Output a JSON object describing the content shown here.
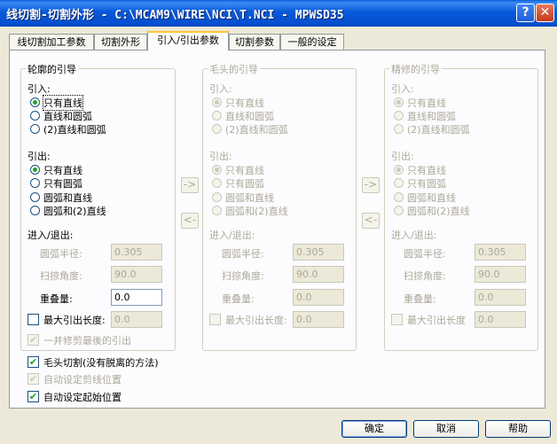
{
  "window": {
    "title": "线切割-切割外形 - C:\\MCAM9\\WIRE\\NCI\\T.NCI - MPWSD35",
    "help_glyph": "?",
    "close_glyph": "✕"
  },
  "tabs": [
    {
      "label": "线切割加工参数"
    },
    {
      "label": "切割外形"
    },
    {
      "label": "引入/引出参数"
    },
    {
      "label": "切割参数"
    },
    {
      "label": "一般的设定"
    }
  ],
  "groups": [
    {
      "title": "轮廓的引导",
      "enabled": true,
      "lead_in_label": "引入:",
      "lead_in_options": [
        "只有直线",
        "直线和圆弧",
        "(2)直线和圆弧"
      ],
      "lead_out_label": "引出:",
      "lead_out_options": [
        "只有直线",
        "只有圆弧",
        "圆弧和直线",
        "圆弧和(2)直线"
      ],
      "entry_exit_label": "进入/退出:",
      "arc_radius_label": "圆弧半径:",
      "arc_radius_value": "0.305",
      "sweep_angle_label": "扫掠角度:",
      "sweep_angle_value": "90.0",
      "overlap_label": "重叠量:",
      "overlap_value": "0.0",
      "max_lead_out_label": "最大引出长度:",
      "max_lead_out_value": "0.0",
      "trim_last_label": "一并修剪最後的引出"
    },
    {
      "title": "毛头的引导",
      "enabled": false,
      "lead_in_label": "引入:",
      "lead_in_options": [
        "只有直线",
        "直线和圆弧",
        "(2)直线和圆弧"
      ],
      "lead_out_label": "引出:",
      "lead_out_options": [
        "只有直线",
        "只有圆弧",
        "圆弧和直线",
        "圆弧和(2)直线"
      ],
      "entry_exit_label": "进入/退出:",
      "arc_radius_label": "圆弧半径:",
      "arc_radius_value": "0.305",
      "sweep_angle_label": "扫掠角度:",
      "sweep_angle_value": "90.0",
      "overlap_label": "重叠量:",
      "overlap_value": "0.0",
      "max_lead_out_label": "最大引出长度:",
      "max_lead_out_value": "0.0"
    },
    {
      "title": "精修的引导",
      "enabled": false,
      "lead_in_label": "引入:",
      "lead_in_options": [
        "只有直线",
        "直线和圆弧",
        "(2)直线和圆弧"
      ],
      "lead_out_label": "引出:",
      "lead_out_options": [
        "只有直线",
        "只有圆弧",
        "圆弧和直线",
        "圆弧和(2)直线"
      ],
      "entry_exit_label": "进入/退出:",
      "arc_radius_label": "圆弧半径:",
      "arc_radius_value": "0.305",
      "sweep_angle_label": "扫掠角度:",
      "sweep_angle_value": "90.0",
      "overlap_label": "重叠量:",
      "overlap_value": "0.0",
      "max_lead_out_label": "最大引出长度",
      "max_lead_out_value": "0.0"
    }
  ],
  "copy_buttons": {
    "right": "->",
    "left": "<-"
  },
  "bottom_options": [
    {
      "label": "毛头切割(没有脱离的方法)",
      "checked": true,
      "enabled": true
    },
    {
      "label": "自动设定剪线位置",
      "checked": true,
      "enabled": false
    },
    {
      "label": "自动设定起始位置",
      "checked": true,
      "enabled": true
    }
  ],
  "check_glyph": "✔",
  "buttons": {
    "ok": "确定",
    "cancel": "取消",
    "help": "帮助"
  }
}
